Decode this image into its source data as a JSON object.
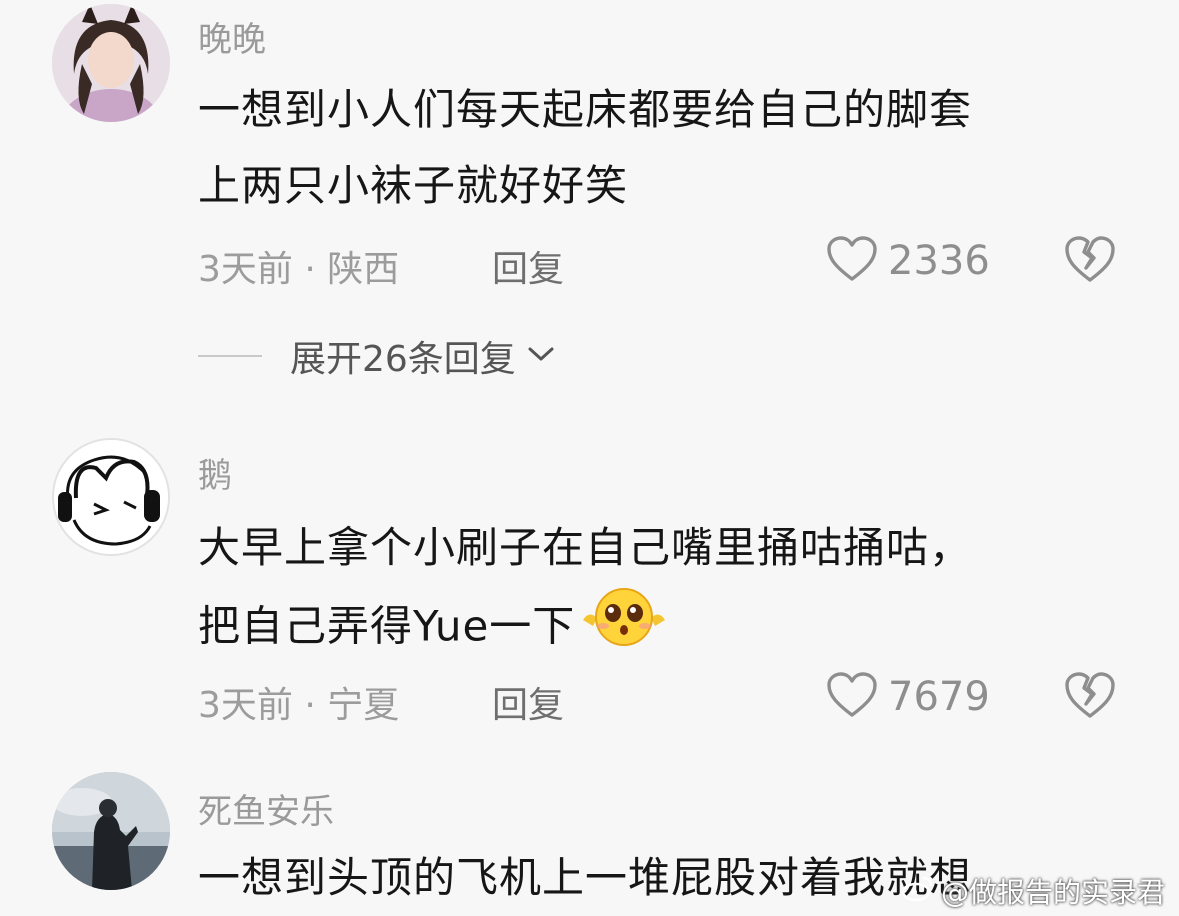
{
  "comments": [
    {
      "username": "晚晚",
      "lines": [
        "一想到小人们每天起床都要给自己的脚套",
        "上两只小袜子就好好笑"
      ],
      "meta": "3天前 · 陕西",
      "reply_label": "回复",
      "likes": "2336",
      "expand_label": "展开26条回复"
    },
    {
      "username": "鹅",
      "lines": [
        "大早上拿个小刷子在自己嘴里捅咕捅咕，",
        "把自己弄得Yue一下"
      ],
      "meta": "3天前 · 宁夏",
      "reply_label": "回复",
      "likes": "7679"
    },
    {
      "username": "死鱼安乐",
      "lines": [
        "一想到头顶的飞机上一堆屁股对着我就想"
      ]
    }
  ],
  "watermark": "@做报告的实录君",
  "icons": {
    "like": "heart-outline-icon",
    "dislike": "broken-heart-icon",
    "expand": "chevron-down-icon",
    "emoji": "pleading-face-emoji",
    "watermark": "weibo-logo-icon"
  },
  "colors": {
    "background": "#f7f7f7",
    "text": "#161616",
    "secondary": "#9a9a9a"
  }
}
